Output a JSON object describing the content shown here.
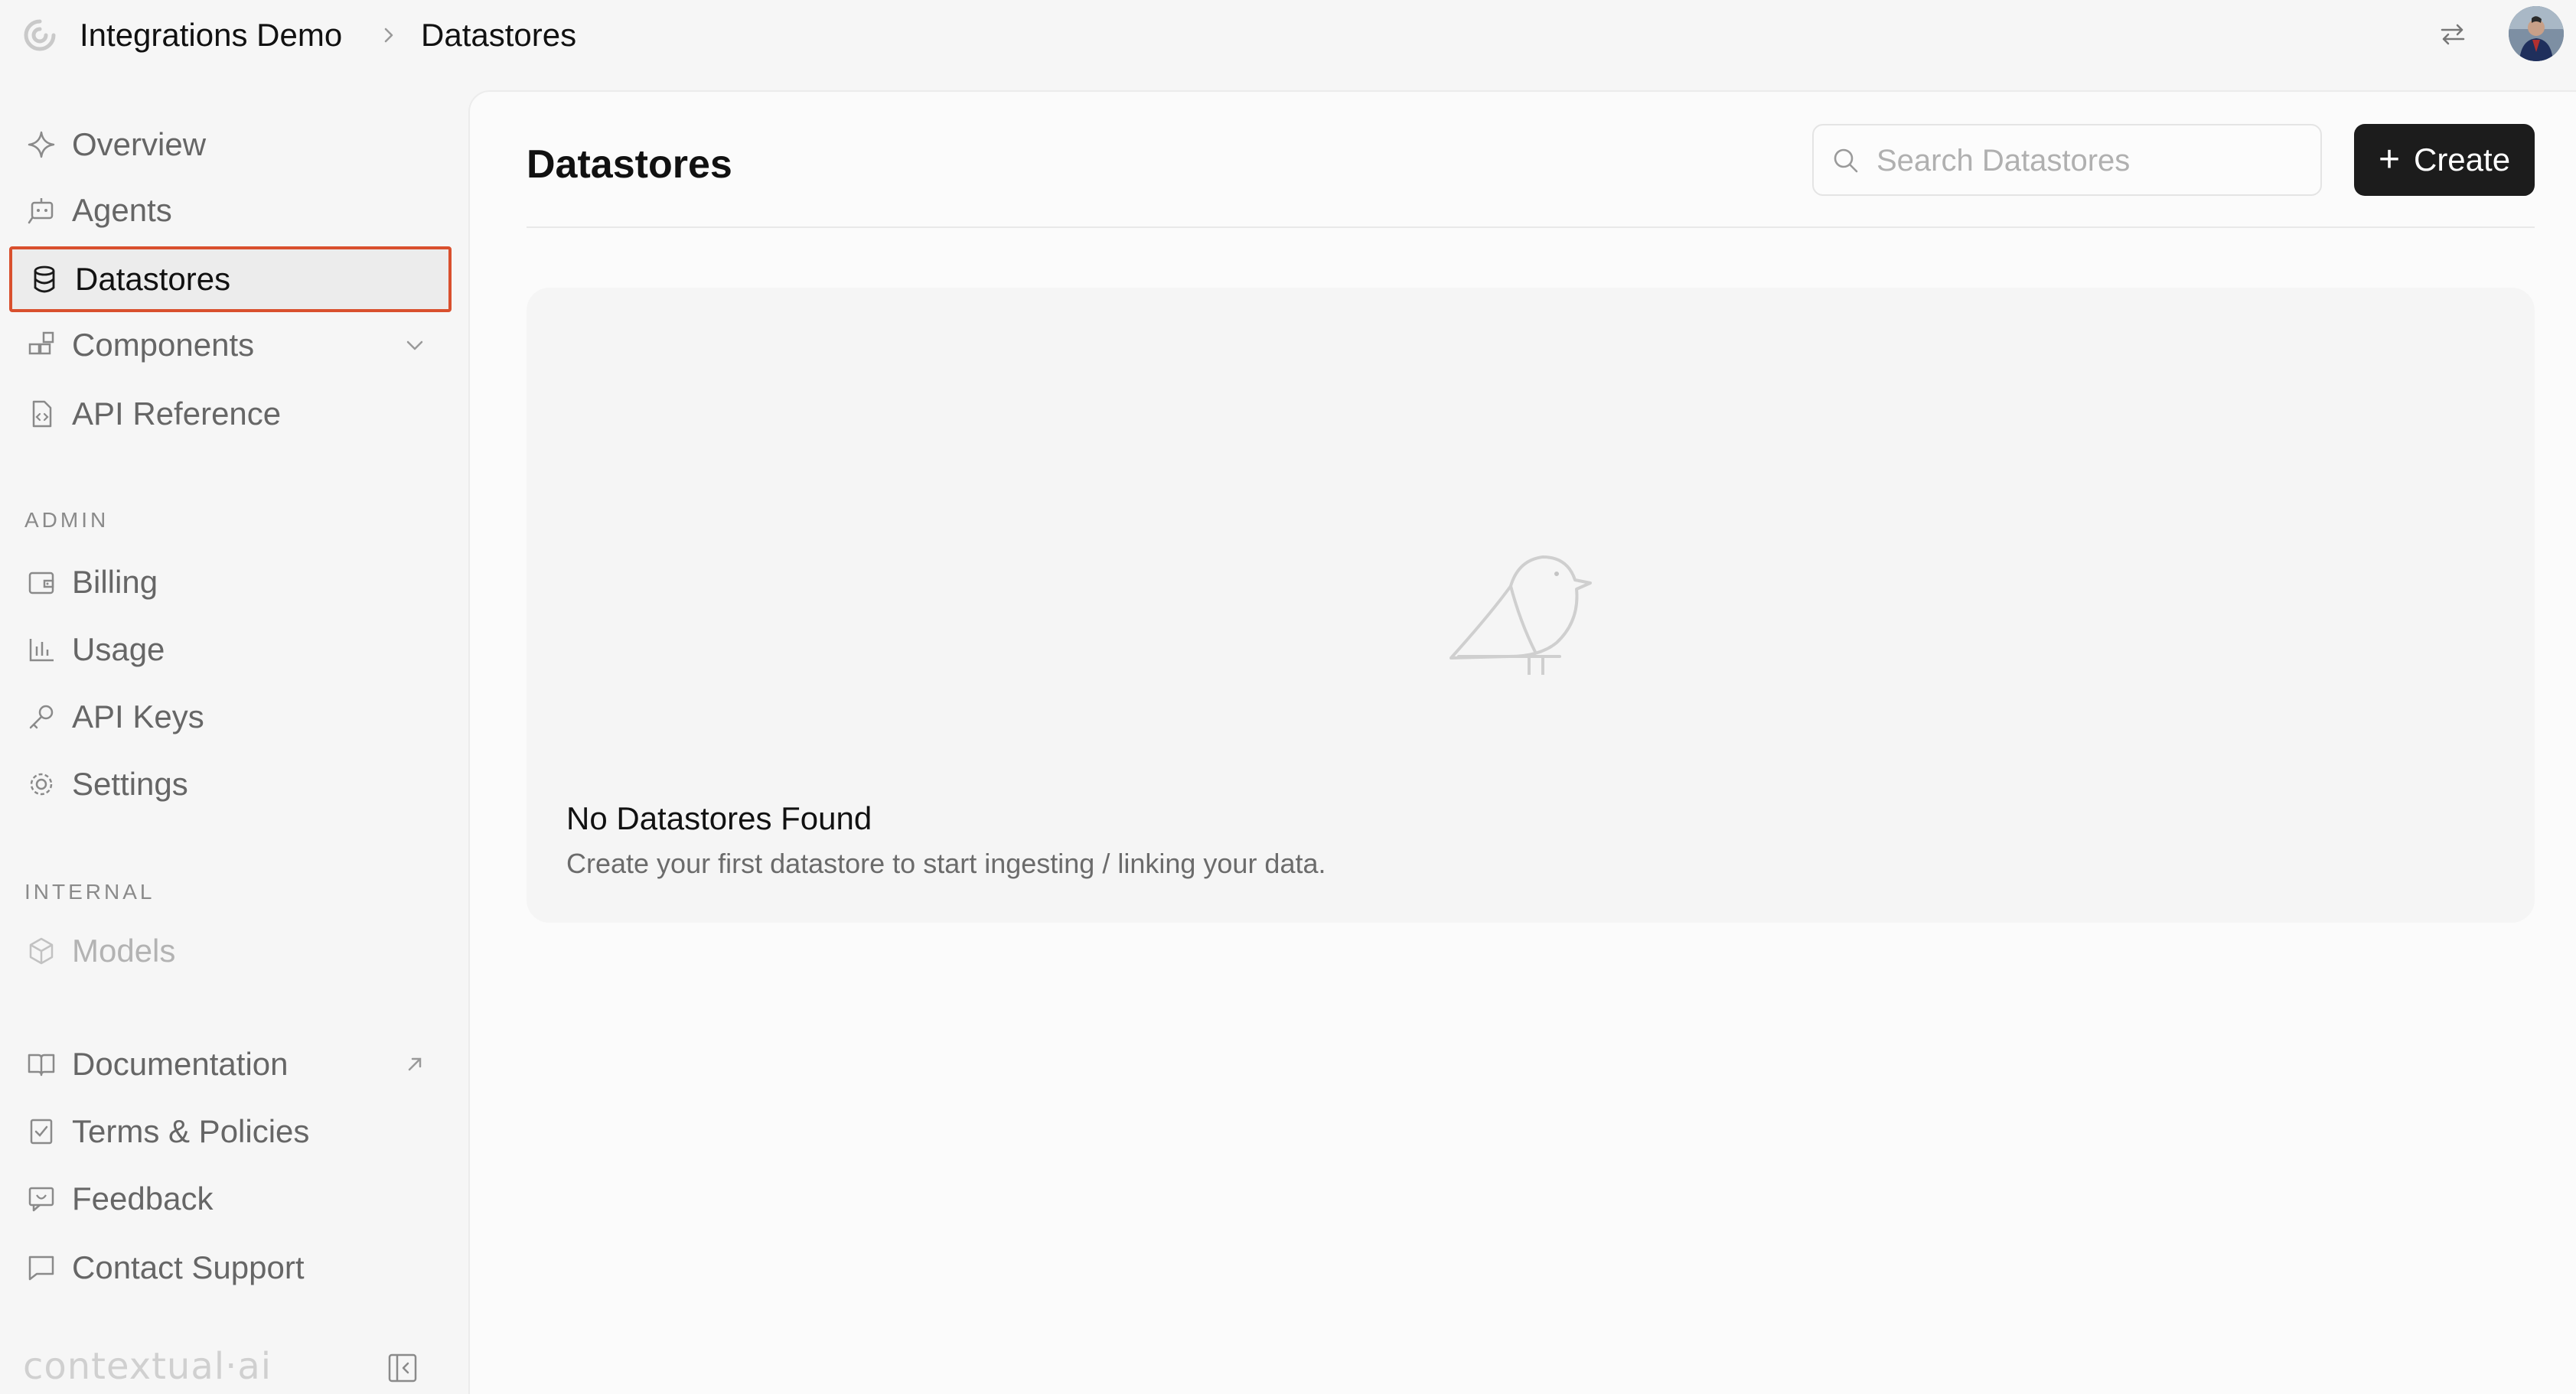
{
  "breadcrumb": {
    "workspace": "Integrations Demo",
    "current": "Datastores"
  },
  "sidebar": {
    "items": [
      {
        "key": "overview",
        "label": "Overview",
        "icon": "sparkle-icon"
      },
      {
        "key": "agents",
        "label": "Agents",
        "icon": "chat-bot-icon"
      },
      {
        "key": "datastores",
        "label": "Datastores",
        "icon": "database-icon",
        "active": true
      },
      {
        "key": "components",
        "label": "Components",
        "icon": "components-icon"
      },
      {
        "key": "api-reference",
        "label": "API Reference",
        "icon": "code-file-icon"
      }
    ],
    "admin_label": "ADMIN",
    "admin_items": [
      {
        "key": "billing",
        "label": "Billing",
        "icon": "wallet-icon"
      },
      {
        "key": "usage",
        "label": "Usage",
        "icon": "bar-chart-icon"
      },
      {
        "key": "api-keys",
        "label": "API Keys",
        "icon": "key-icon"
      },
      {
        "key": "settings",
        "label": "Settings",
        "icon": "gear-icon"
      }
    ],
    "internal_label": "INTERNAL",
    "internal_items": [
      {
        "key": "models",
        "label": "Models",
        "icon": "cube-icon"
      }
    ],
    "footer_items": [
      {
        "key": "documentation",
        "label": "Documentation",
        "icon": "book-icon"
      },
      {
        "key": "terms",
        "label": "Terms & Policies",
        "icon": "checklist-icon"
      },
      {
        "key": "feedback",
        "label": "Feedback",
        "icon": "feedback-icon"
      },
      {
        "key": "support",
        "label": "Contact Support",
        "icon": "message-icon"
      }
    ],
    "brand": "contextual·ai"
  },
  "main": {
    "title": "Datastores",
    "search_placeholder": "Search Datastores",
    "create_label": "Create",
    "empty_title": "No Datastores Found",
    "empty_description": "Create your first datastore to start ingesting / linking your data."
  },
  "colors": {
    "active_outline": "#d9502e",
    "primary_button": "#1c1c1c"
  }
}
